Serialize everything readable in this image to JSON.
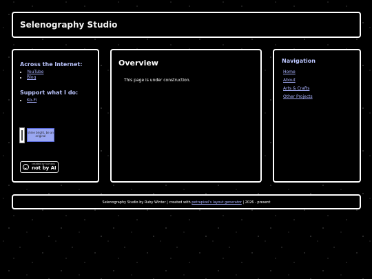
{
  "header": {
    "title": "Selenography Studio"
  },
  "left": {
    "internet_heading": "Across the Internet:",
    "internet_links": [
      "YouTube",
      "Blog"
    ],
    "support_heading": "Support what I do:",
    "support_links": [
      "Ko-Fi"
    ],
    "blinkie_text": "shine bright, be an original",
    "badge_small": "created by humans",
    "badge_big": "not by AI"
  },
  "center": {
    "title": "Overview",
    "body": "This page is under construction."
  },
  "right": {
    "heading": "Navigation",
    "nav": [
      "Home",
      "About",
      "Arts & Crafts",
      "Other Projects"
    ]
  },
  "footer": {
    "prefix": "Selenography Studio by Ruby Winter | created with ",
    "link": "petrapixel's layout generator",
    "suffix": " | 2026 - present"
  },
  "colors": {
    "background": "#000000",
    "border": "#ffffff",
    "link": "#a9b2ff",
    "heading": "#bcc6ff"
  }
}
